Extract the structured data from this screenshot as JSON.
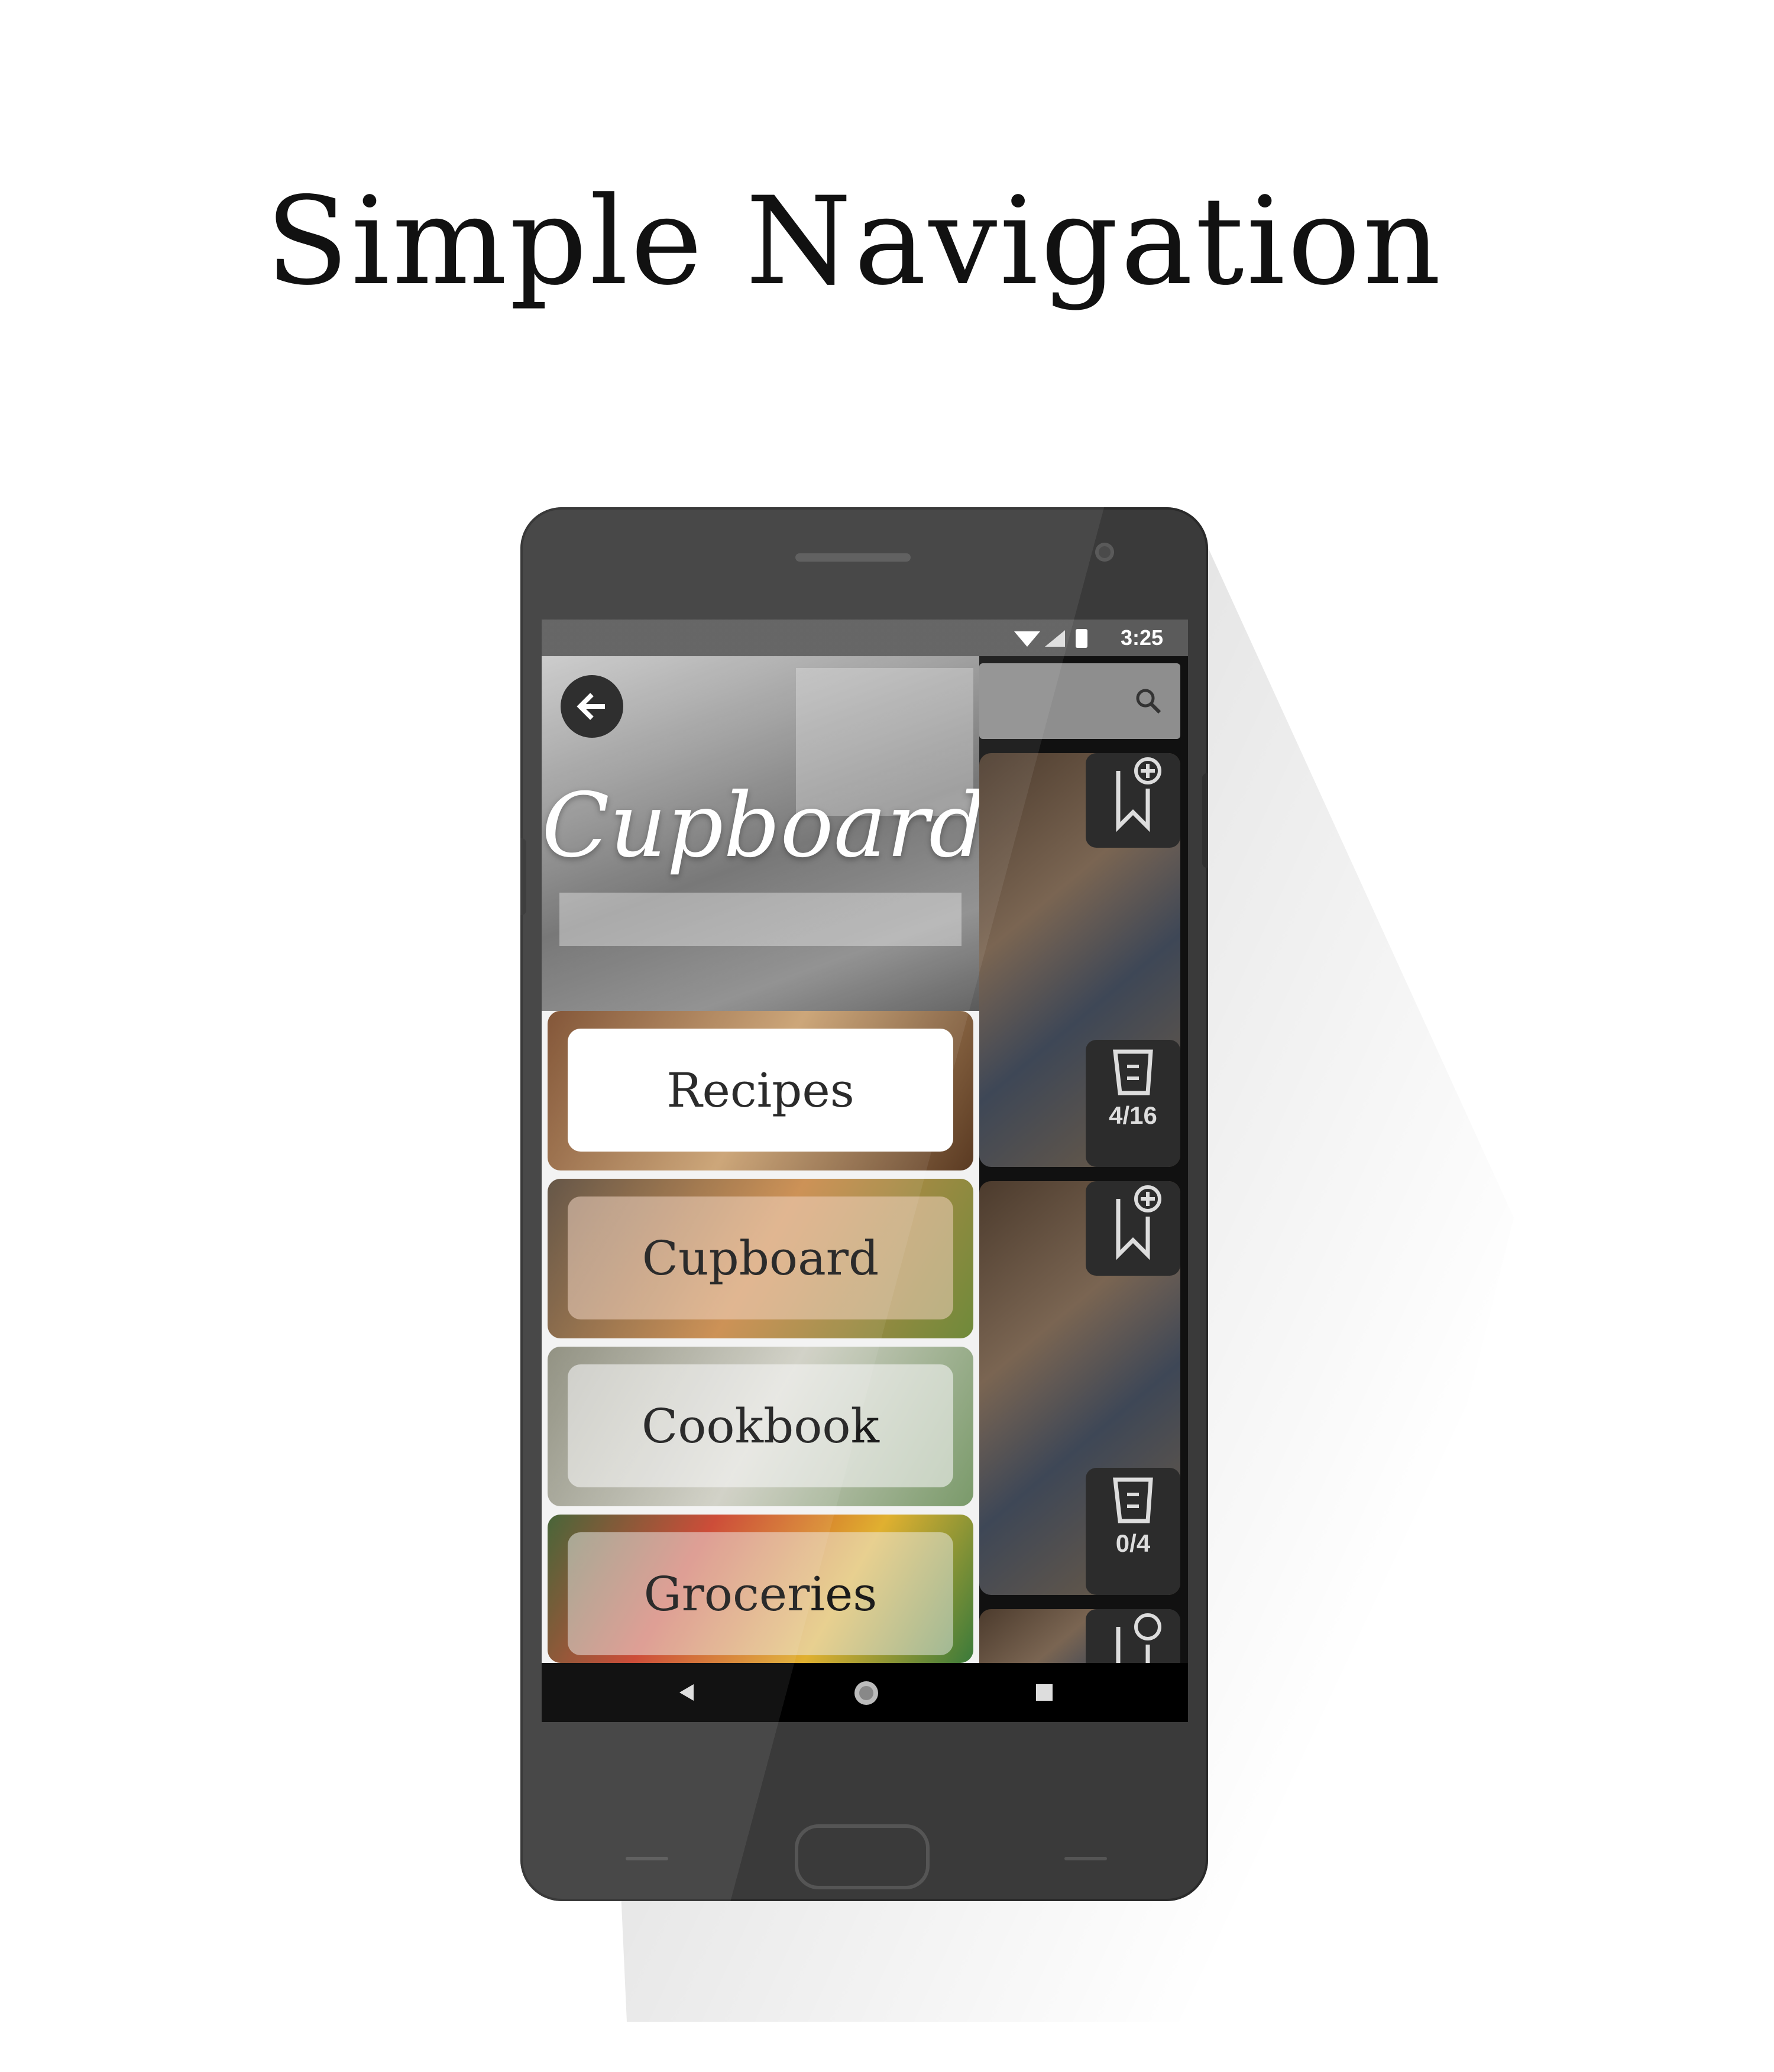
{
  "headline": "Simple Navigation",
  "status_bar": {
    "time": "3:25",
    "icons": [
      "wifi-icon",
      "signal-icon",
      "battery-icon"
    ]
  },
  "drawer": {
    "brand": "Cupboard",
    "back_icon": "arrow-left-icon",
    "items": [
      {
        "label": "Recipes",
        "selected": true
      },
      {
        "label": "Cupboard",
        "selected": false
      },
      {
        "label": "Cookbook",
        "selected": false
      },
      {
        "label": "Groceries",
        "selected": false
      }
    ]
  },
  "feed": {
    "cards": [
      {
        "ingredient_count": "4/16"
      },
      {
        "ingredient_count": "0/4"
      }
    ]
  },
  "nav_bar": {
    "icons": [
      "back-triangle-icon",
      "home-circle-icon",
      "recents-square-icon"
    ]
  }
}
